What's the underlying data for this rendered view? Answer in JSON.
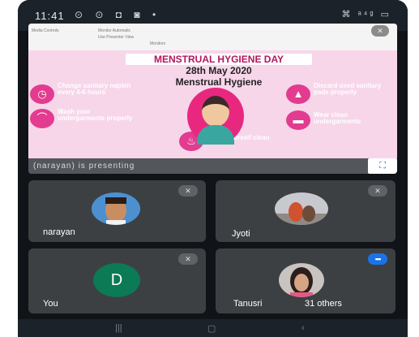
{
  "photo_label": "e",
  "status_bar": {
    "time": "11:41",
    "left_icons": "⊙ ⊙ ◘ ◙ •",
    "right_icons": "⌘ ᵃ⁴ᵍ ▭"
  },
  "ppt_toolbar": {
    "items": [
      "Media Controls",
      "Monitor Automatic",
      "Use Presenter View",
      "Monitors"
    ]
  },
  "slide": {
    "title": "MENSTRUAL HYGIENE DAY",
    "date": "28th May 2020",
    "subtitle": "Menstrual Hygiene",
    "tips": [
      "Change sanitary napkin every 4-6 hours",
      "Wash your undergarments properly",
      "Keep yourself clean",
      "Discard used sanitary pads properly",
      "Wear clean undergarments"
    ]
  },
  "presenting": {
    "text": "(narayan) is presenting"
  },
  "tiles": [
    {
      "name": "narayan",
      "muted": true
    },
    {
      "name": "Jyoti",
      "muted": true
    },
    {
      "name": "You",
      "avatar_letter": "D",
      "muted": true
    },
    {
      "name": "Tanusri",
      "extra": "31 others",
      "speaking": true
    }
  ],
  "colors": {
    "slide_bg": "#f7d6ea",
    "accent_pink": "#e23b8f",
    "tile_bg": "#3c4043",
    "you_avatar": "#0b7a55",
    "speaking_blue": "#1a73e8"
  }
}
